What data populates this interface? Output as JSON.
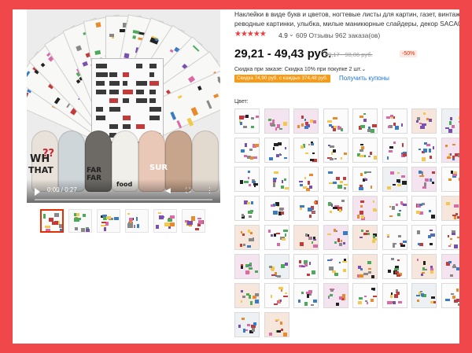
{
  "product": {
    "title_line1": "Наклейки в виде букв и цветов, ногтевые листы для картин, газет, винтажные",
    "title_line2": "реводные картинки, улыбка, милые маникюрные слайдеры, декор SACA017-40",
    "rating_stars": "★★★★★",
    "rating_value": "4.9",
    "rating_chevron": "⌄",
    "reviews": "609 Отзывы",
    "orders": "962 заказа(ов)",
    "price_range": "29,21 - 49,43 руб.",
    "old_price": "59,17 - 98,86 руб.",
    "discount": "-50%",
    "bulk_discount": "Скидка при заказе: Скидка 10% при покупке 2 шт.",
    "bulk_chevron": "⌄",
    "coupon_badge": "Скидка 74,90 руб. с каждых 374,48 руб.",
    "coupon_link": "Получить купоны",
    "color_label": "Цвет:"
  },
  "video": {
    "time": "0:00 / 0:27",
    "progress": 0,
    "icons": [
      "play-icon",
      "volume-icon",
      "fullscreen-icon",
      "more-icon"
    ],
    "volume_glyph": "◀",
    "fullscreen_glyph": "⛶",
    "more_glyph": "⋮",
    "overlay_texts": [
      "WH",
      "??",
      "THAT",
      "FAR",
      "FAR",
      "food",
      "SUR"
    ]
  },
  "thumbnails": [
    {
      "selected": true
    },
    {
      "selected": false
    },
    {
      "selected": false
    },
    {
      "selected": false
    },
    {
      "selected": false
    },
    {
      "selected": false
    }
  ],
  "swatch_count": 58,
  "colors": {
    "page_background": "#f0484a",
    "accent": "#e62e04",
    "star": "#f5393b",
    "coupon_badge": "#f79a16",
    "link": "#1a73e8"
  }
}
